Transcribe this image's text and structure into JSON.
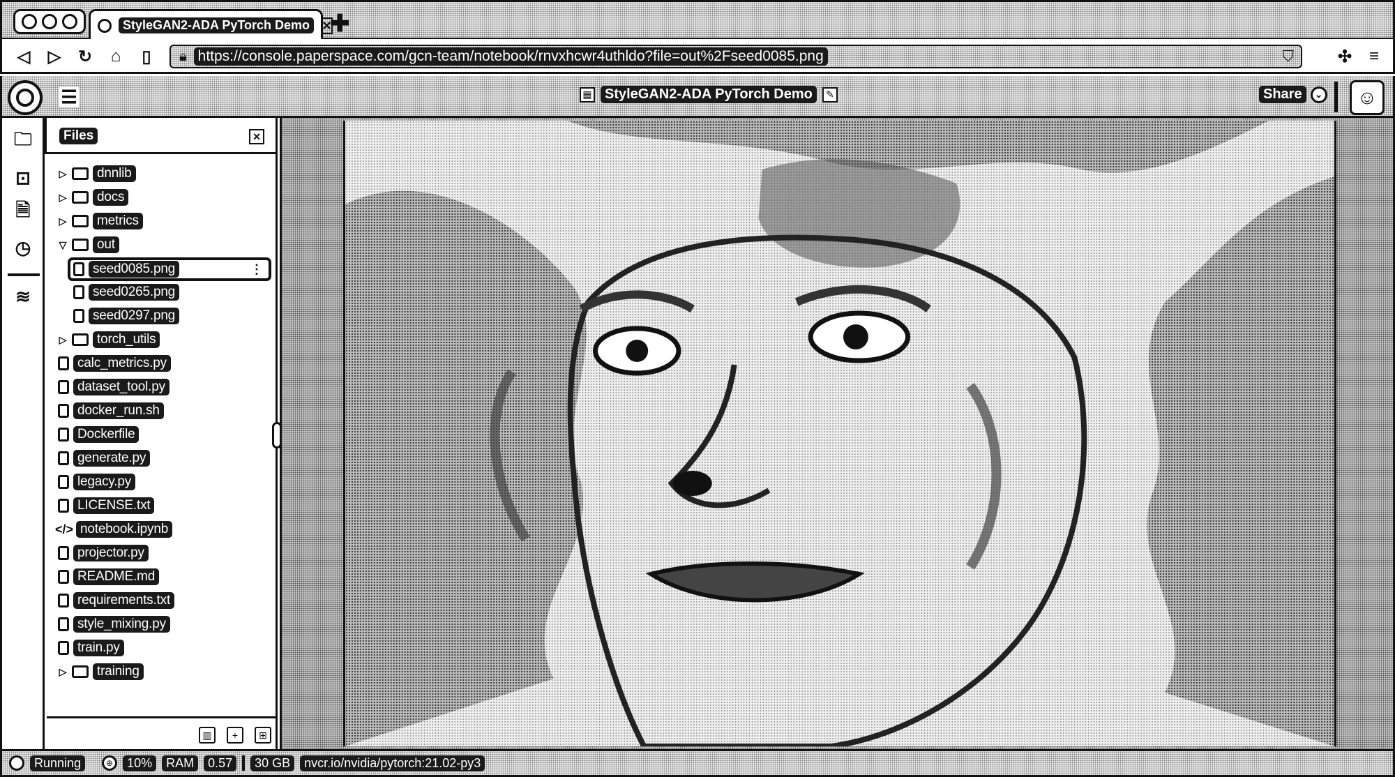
{
  "browser": {
    "tab_title": "StyleGAN2-ADA PyTorch Demo",
    "url": "https://console.paperspace.com/gcn-team/notebook/rnvxhcwr4uthldo?file=out%2Fseed0085.png"
  },
  "app": {
    "notebook_title": "StyleGAN2-ADA PyTorch Demo",
    "share_label": "Share"
  },
  "files_panel": {
    "title": "Files",
    "items": [
      {
        "label": "dnnlib",
        "kind": "folder",
        "expanded": false
      },
      {
        "label": "docs",
        "kind": "folder",
        "expanded": false
      },
      {
        "label": "metrics",
        "kind": "folder",
        "expanded": false
      },
      {
        "label": "out",
        "kind": "folder",
        "expanded": true
      },
      {
        "label": "seed0085.png",
        "kind": "file",
        "selected": true
      },
      {
        "label": "seed0265.png",
        "kind": "file"
      },
      {
        "label": "seed0297.png",
        "kind": "file"
      },
      {
        "label": "torch_utils",
        "kind": "folder",
        "expanded": false
      },
      {
        "label": "calc_metrics.py",
        "kind": "file"
      },
      {
        "label": "dataset_tool.py",
        "kind": "file"
      },
      {
        "label": "docker_run.sh",
        "kind": "file"
      },
      {
        "label": "Dockerfile",
        "kind": "file"
      },
      {
        "label": "generate.py",
        "kind": "file"
      },
      {
        "label": "legacy.py",
        "kind": "file"
      },
      {
        "label": "LICENSE.txt",
        "kind": "file"
      },
      {
        "label": "notebook.ipynb",
        "kind": "notebook"
      },
      {
        "label": "projector.py",
        "kind": "file"
      },
      {
        "label": "README.md",
        "kind": "file"
      },
      {
        "label": "requirements.txt",
        "kind": "file"
      },
      {
        "label": "style_mixing.py",
        "kind": "file"
      },
      {
        "label": "train.py",
        "kind": "file"
      },
      {
        "label": "training",
        "kind": "folder",
        "expanded": false
      }
    ]
  },
  "status_bar": {
    "state": "Running",
    "cpu": "10%",
    "ram_label": "RAM",
    "ram_used": "0.57",
    "ram_total": "30 GB",
    "container": "nvcr.io/nvidia/pytorch:21.02-py3"
  },
  "icons": {
    "back": "back-icon",
    "forward": "forward-icon",
    "reload": "reload-icon",
    "home": "home-icon",
    "bookmark": "bookmark-icon",
    "lock": "lock-icon",
    "extensions": "puzzle-icon",
    "menu": "menu-icon"
  }
}
